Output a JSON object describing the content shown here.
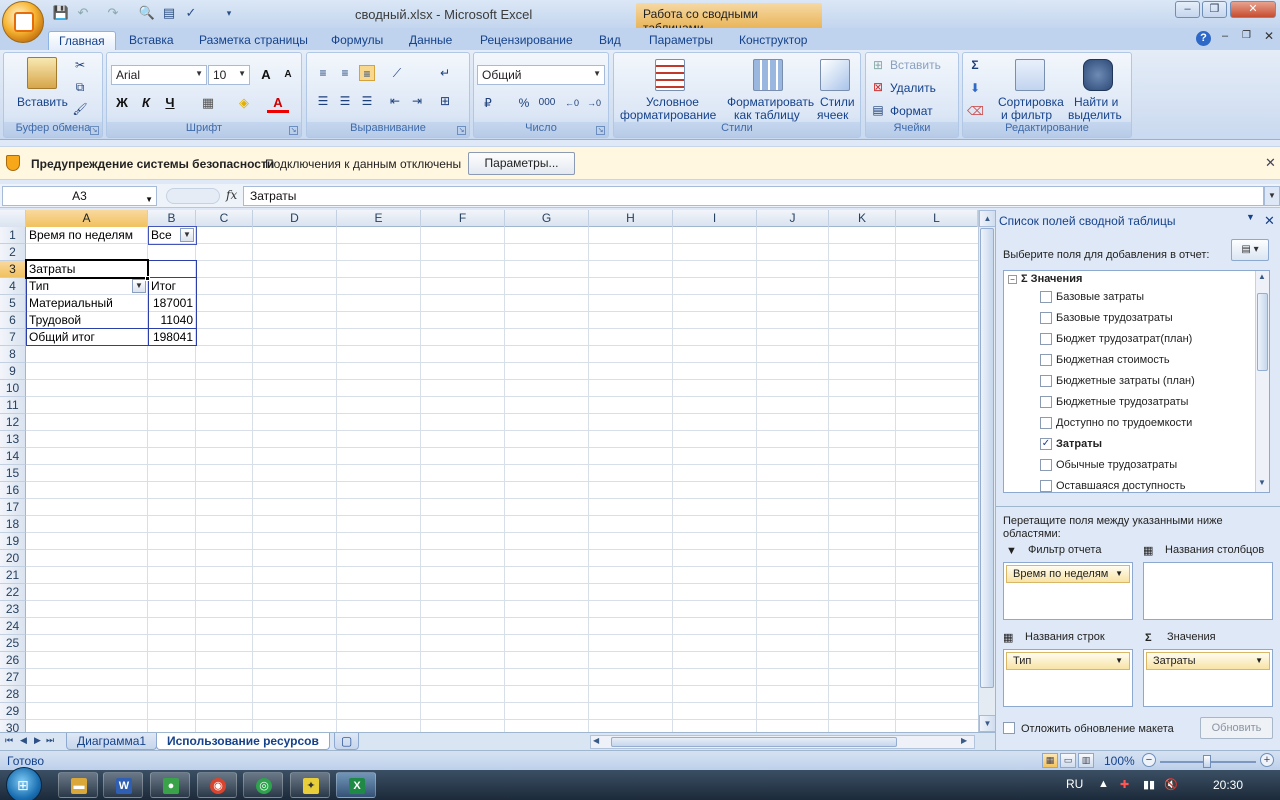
{
  "window": {
    "title": "сводный.xlsx - Microsoft Excel",
    "context_title": "Работа со сводными таблицами"
  },
  "tabs": [
    {
      "label": "Главная",
      "active": true
    },
    {
      "label": "Вставка"
    },
    {
      "label": "Разметка страницы"
    },
    {
      "label": "Формулы"
    },
    {
      "label": "Данные"
    },
    {
      "label": "Рецензирование"
    },
    {
      "label": "Вид"
    },
    {
      "label": "Параметры"
    },
    {
      "label": "Конструктор"
    }
  ],
  "ribbon": {
    "clipboard": {
      "label": "Буфер обмена",
      "paste": "Вставить"
    },
    "font": {
      "label": "Шрифт",
      "name": "Arial",
      "size": "10",
      "bold": "Ж",
      "italic": "К",
      "underline": "Ч",
      "grow": "A",
      "shrink": "A",
      "color": "A"
    },
    "alignment": {
      "label": "Выравнивание"
    },
    "number": {
      "label": "Число",
      "format": "Общий",
      "percent": "%",
      "thousands": "000"
    },
    "styles": {
      "label": "Стили",
      "cond_line1": "Условное",
      "cond_line2": "форматирование",
      "table_line1": "Форматировать",
      "table_line2": "как таблицу",
      "cell_line1": "Стили",
      "cell_line2": "ячеек"
    },
    "cells": {
      "label": "Ячейки",
      "insert": "Вставить",
      "delete": "Удалить",
      "format": "Формат"
    },
    "editing": {
      "label": "Редактирование",
      "sort_line1": "Сортировка",
      "sort_line2": "и фильтр",
      "find_line1": "Найти и",
      "find_line2": "выделить",
      "sum": "Σ"
    }
  },
  "security": {
    "warning": "Предупреждение системы безопасности",
    "info": "Подключения к данным отключены",
    "button": "Параметры..."
  },
  "formula_bar": {
    "name_box": "A3",
    "fx": "fx",
    "formula": "Затраты"
  },
  "grid": {
    "columns": [
      "A",
      "B",
      "C",
      "D",
      "E",
      "F",
      "G",
      "H",
      "I",
      "J",
      "K",
      "L"
    ],
    "rows": [
      "1",
      "2",
      "3",
      "4",
      "5",
      "6",
      "7",
      "8",
      "9",
      "10",
      "11",
      "12",
      "13",
      "14",
      "15",
      "16",
      "17",
      "18",
      "19",
      "20",
      "21",
      "22",
      "23",
      "24",
      "25",
      "26",
      "27",
      "28",
      "29",
      "30"
    ],
    "cells": {
      "a1": "Время по неделям",
      "b1": "Все",
      "a3": "Затраты",
      "a4": "Тип",
      "b4": "Итог",
      "a5": "Материальный",
      "b5": "187001",
      "a6": "Трудовой",
      "b6": "11040",
      "a7": "Общий итог",
      "b7": "198041"
    }
  },
  "sheets": [
    {
      "label": "Диаграмма1"
    },
    {
      "label": "Использование ресурсов",
      "active": true
    }
  ],
  "pivot_pane": {
    "title": "Список полей сводной таблицы",
    "choose": "Выберите поля для добавления в отчет:",
    "values_group": "Значения",
    "fields": [
      {
        "label": "Базовые затраты",
        "checked": false
      },
      {
        "label": "Базовые трудозатраты",
        "checked": false
      },
      {
        "label": "Бюджет трудозатрат(план)",
        "checked": false
      },
      {
        "label": "Бюджетная стоимость",
        "checked": false
      },
      {
        "label": "Бюджетные затраты (план)",
        "checked": false
      },
      {
        "label": "Бюджетные трудозатраты",
        "checked": false
      },
      {
        "label": "Доступно по трудоемкости",
        "checked": false
      },
      {
        "label": "Затраты",
        "checked": true
      },
      {
        "label": "Обычные трудозатраты",
        "checked": false
      },
      {
        "label": "Оставшаяся доступность",
        "checked": false
      }
    ],
    "drag_text": "Перетащите поля между указанными ниже областями:",
    "areas": {
      "filter": {
        "label": "Фильтр отчета",
        "item": "Время по неделям"
      },
      "columns": {
        "label": "Названия столбцов"
      },
      "rows": {
        "label": "Названия строк",
        "item": "Тип"
      },
      "values": {
        "label": "Значения",
        "item": "Затраты"
      }
    },
    "defer": "Отложить обновление макета",
    "update": "Обновить"
  },
  "status": {
    "text": "Готово",
    "zoom": "100%"
  },
  "taskbar": {
    "lang": "RU",
    "clock": "20:30"
  }
}
